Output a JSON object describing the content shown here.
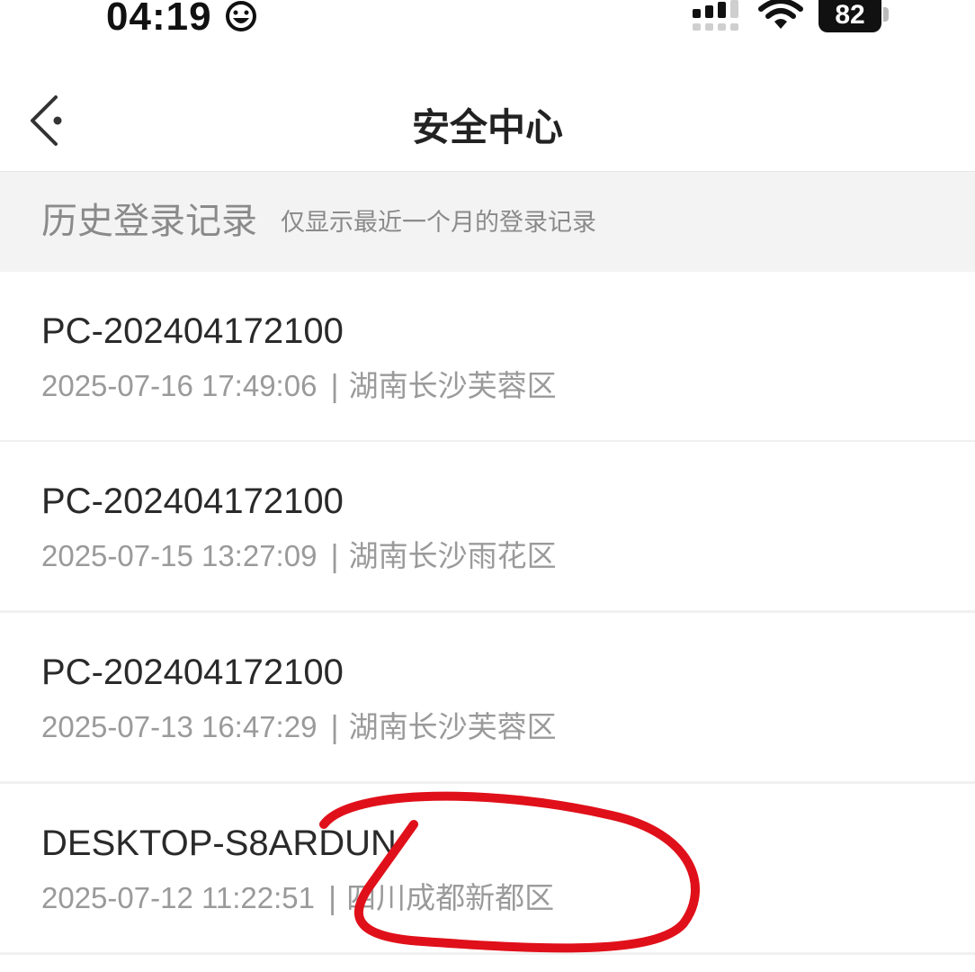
{
  "status_bar": {
    "time": "04:19",
    "battery": "82"
  },
  "nav": {
    "title": "安全中心"
  },
  "section": {
    "title": "历史登录记录",
    "subtitle": "仅显示最近一个月的登录记录"
  },
  "records": [
    {
      "device": "PC-202404172100",
      "time": "2025-07-16 17:49:06",
      "separator": "|",
      "location": "湖南长沙芙蓉区"
    },
    {
      "device": "PC-202404172100",
      "time": "2025-07-15 13:27:09",
      "separator": "|",
      "location": "湖南长沙雨花区"
    },
    {
      "device": "PC-202404172100",
      "time": "2025-07-13 16:47:29",
      "separator": "|",
      "location": "湖南长沙芙蓉区"
    },
    {
      "device": "DESKTOP-S8ARDUN",
      "time": "2025-07-12 11:22:51",
      "separator": "|",
      "location": "四川成都新都区"
    }
  ],
  "colors": {
    "annotation": "#e0101a",
    "section_bg": "#f3f3f3",
    "muted_text": "#9a9a9a"
  },
  "icons": {
    "back": "back-arrow-icon",
    "smiley": "smiley-face-icon",
    "signal": "cellular-signal-icon",
    "wifi": "wifi-icon"
  }
}
